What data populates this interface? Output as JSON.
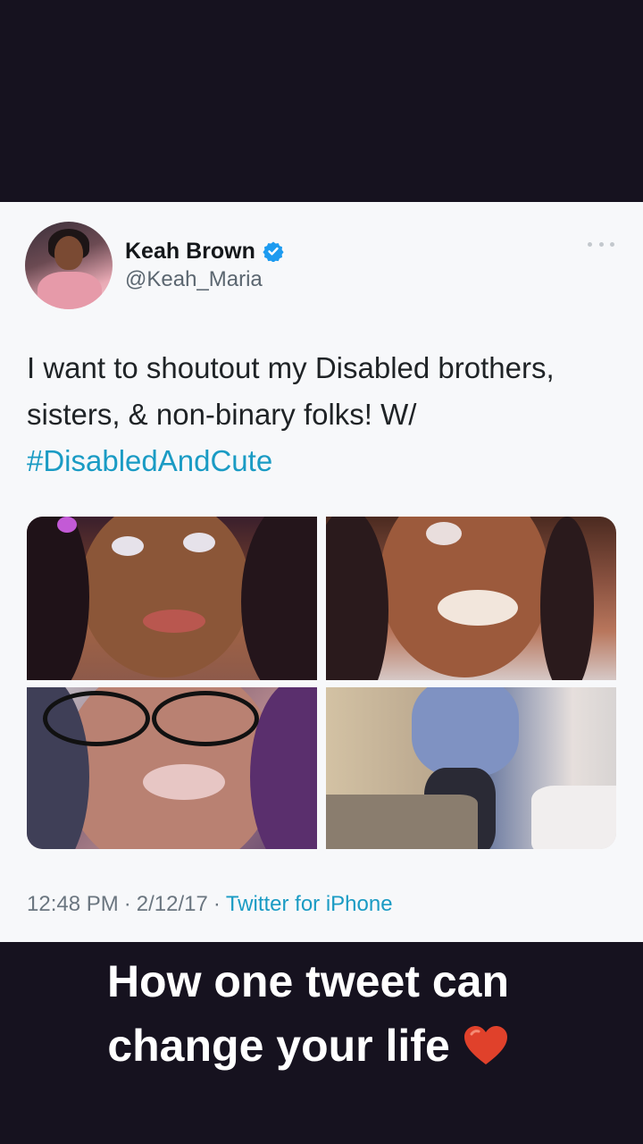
{
  "tweet": {
    "display_name": "Keah Brown",
    "handle": "@Keah_Maria",
    "text_plain": "I want to shoutout my Disabled brothers, sisters, & non-binary folks! W/ ",
    "hashtag": "#DisabledAndCute",
    "time": "12:48 PM",
    "date": "2/12/17",
    "source": "Twitter for iPhone",
    "separator": "·"
  },
  "caption": {
    "line1": "How one tweet can",
    "line2": "change your life"
  },
  "colors": {
    "background": "#16121f",
    "card": "#f7f8fa",
    "link": "#1a9bc4",
    "verified": "#1d9bf0",
    "heart": "#e0412b"
  },
  "icons": [
    "verified-badge-icon",
    "more-options-icon",
    "heart-icon"
  ]
}
